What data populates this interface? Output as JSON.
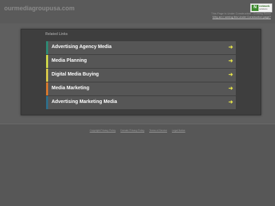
{
  "header": {
    "domain": "ourmediagroupusa.com",
    "badge_logo": "N",
    "badge_line1": "network",
    "badge_line2": "solutions",
    "notice_line1": "This Page Is Under Construction - Coming Soon!",
    "notice_link": "Why am I seeing this Under Construction page?"
  },
  "main": {
    "heading": "Related Links",
    "arrow_glyph": "➜",
    "links": [
      {
        "label": "Advertising Agency Media",
        "color": "#2e8a74"
      },
      {
        "label": "Media Planning",
        "color": "#cfd84a"
      },
      {
        "label": "Digital Media Buying",
        "color": "#d8c94a"
      },
      {
        "label": "Media Marketing",
        "color": "#d8782e"
      },
      {
        "label": "Advertising Marketing Media",
        "color": "#2e6e8a"
      }
    ]
  },
  "footer": {
    "links": [
      "Copyright Privacy Policy",
      "Domain Privacy Policy",
      "Terms of Service",
      "Legal Notice"
    ]
  }
}
